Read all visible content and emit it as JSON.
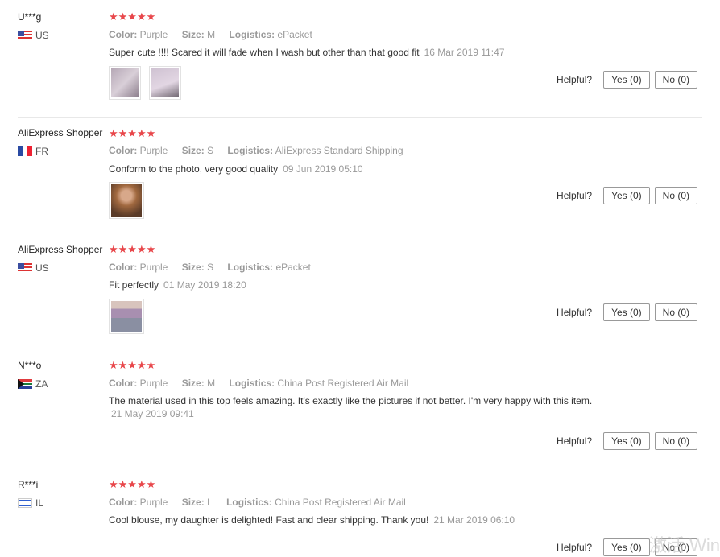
{
  "helpful_label": "Helpful?",
  "reviews": [
    {
      "user": "U***g",
      "country": "US",
      "stars": "★★★★★",
      "color_label": "Color:",
      "color": "Purple",
      "size_label": "Size:",
      "size": "M",
      "logistics_label": "Logistics:",
      "logistics": "ePacket",
      "text": "Super cute !!!! Scared it will fade when I wash but other than that good fit",
      "date": "16 Mar 2019 11:47",
      "yes": "Yes (0)",
      "no": "No (0)"
    },
    {
      "user": "AliExpress Shopper",
      "country": "FR",
      "stars": "★★★★★",
      "color_label": "Color:",
      "color": "Purple",
      "size_label": "Size:",
      "size": "S",
      "logistics_label": "Logistics:",
      "logistics": "AliExpress Standard Shipping",
      "text": "Conform to the photo, very good quality",
      "date": "09 Jun 2019 05:10",
      "yes": "Yes (0)",
      "no": "No (0)"
    },
    {
      "user": "AliExpress Shopper",
      "country": "US",
      "stars": "★★★★★",
      "color_label": "Color:",
      "color": "Purple",
      "size_label": "Size:",
      "size": "S",
      "logistics_label": "Logistics:",
      "logistics": "ePacket",
      "text": "Fit perfectly",
      "date": "01 May 2019 18:20",
      "yes": "Yes (0)",
      "no": "No (0)"
    },
    {
      "user": "N***o",
      "country": "ZA",
      "stars": "★★★★★",
      "color_label": "Color:",
      "color": "Purple",
      "size_label": "Size:",
      "size": "M",
      "logistics_label": "Logistics:",
      "logistics": "China Post Registered Air Mail",
      "text": "The material used in this top feels amazing. It's exactly like the pictures if not better. I'm very happy with this item.",
      "date": "21 May 2019 09:41",
      "yes": "Yes (0)",
      "no": "No (0)"
    },
    {
      "user": "R***i",
      "country": "IL",
      "stars": "★★★★★",
      "color_label": "Color:",
      "color": "Purple",
      "size_label": "Size:",
      "size": "L",
      "logistics_label": "Logistics:",
      "logistics": "China Post Registered Air Mail",
      "text": "Cool blouse, my daughter is delighted! Fast and clear shipping. Thank you!",
      "date": "21 Mar 2019 06:10",
      "yes": "Yes (0)",
      "no": "No (0)"
    }
  ],
  "watermark": "激活 Win"
}
